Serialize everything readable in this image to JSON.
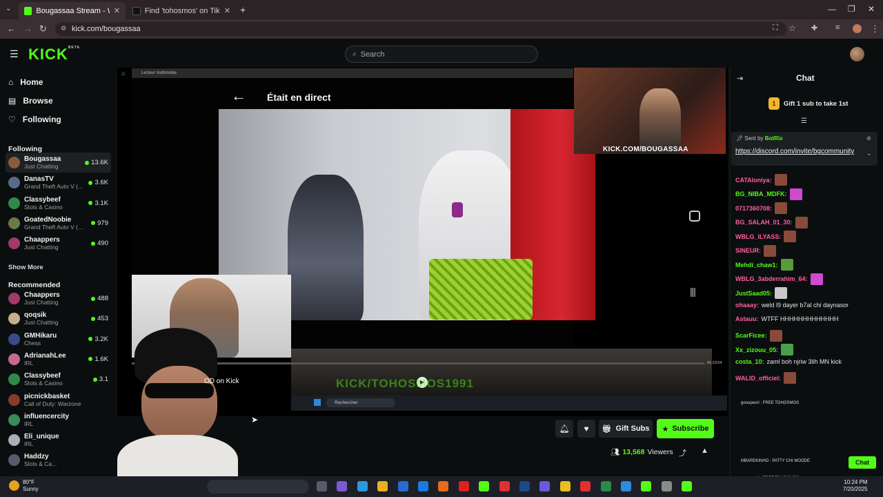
{
  "browser": {
    "tabs": [
      {
        "title": "Bougassaa Stream - Watch Live",
        "active": true
      },
      {
        "title": "Find 'tohosmos' on TikTok | Tik",
        "active": false
      }
    ],
    "url": "kick.com/bougassaa"
  },
  "header": {
    "logo": "KICK",
    "logo_tag": "BETA",
    "search_placeholder": "Search"
  },
  "sidebar": {
    "nav": [
      {
        "label": "Home",
        "icon": "home-icon"
      },
      {
        "label": "Browse",
        "icon": "browse-icon"
      },
      {
        "label": "Following",
        "icon": "heart-icon"
      }
    ],
    "following_title": "Following",
    "following": [
      {
        "name": "Bougassaa",
        "category": "Just Chatting",
        "viewers": "13.6K",
        "color": "#8a5a3a"
      },
      {
        "name": "DanasTV",
        "category": "Grand Theft Auto V (...",
        "viewers": "3.6K",
        "color": "#5a6a8a"
      },
      {
        "name": "Classybeef",
        "category": "Slots & Casino",
        "viewers": "3.1K",
        "color": "#2f8a4a"
      },
      {
        "name": "GoatedNoobie",
        "category": "Grand Theft Auto V (G...",
        "viewers": "979",
        "color": "#6a7a4a"
      },
      {
        "name": "Chaappers",
        "category": "Just Chatting",
        "viewers": "490",
        "color": "#a03a6a"
      }
    ],
    "show_more": "Show More",
    "recommended_title": "Recommended",
    "recommended": [
      {
        "name": "Chaappers",
        "category": "Just Chatting",
        "viewers": "488",
        "color": "#a03a6a"
      },
      {
        "name": "qoqsik",
        "category": "Just Chatting",
        "viewers": "453",
        "color": "#c4b08a"
      },
      {
        "name": "GMHikaru",
        "category": "Chess",
        "viewers": "3.2K",
        "color": "#3a4a8a"
      },
      {
        "name": "AdrianahLee",
        "category": "IRL",
        "viewers": "1.6K",
        "color": "#c46a8a"
      },
      {
        "name": "Classybeef",
        "category": "Slots & Casino",
        "viewers": "3.1",
        "color": "#2f8a4a"
      },
      {
        "name": "picnickbasket",
        "category": "Call of Duty: Warzone",
        "viewers": "",
        "color": "#8a3a2a"
      },
      {
        "name": "influencercity",
        "category": "IRL",
        "viewers": "",
        "color": "#3a8a5a"
      },
      {
        "name": "Eli_unique",
        "category": "IRL",
        "viewers": "",
        "color": "#aab0b8"
      },
      {
        "name": "Haddzy",
        "category": "Slots & Ca...",
        "viewers": "",
        "color": "#5a5a6a"
      }
    ]
  },
  "video": {
    "media_player_title": "Lecteur multimédia",
    "status_text": "Était en direct",
    "webcam_label": "KICK.COM/BOUGASSAA",
    "vod_text": "OD on Kick",
    "watermark": "KICK/TOHOSMOS1991",
    "inner_search": "Rechercher",
    "inner_time": "01:23:54"
  },
  "actions": {
    "gift_label": "Gift Subs",
    "subscribe_label": "Subscribe",
    "viewers_count": "13,568",
    "viewers_label": "Viewers"
  },
  "chat": {
    "title": "Chat",
    "gift_banner": "Gift 1 sub to take 1st",
    "gift_badge": "1",
    "pinned_sent_by_prefix": "Sent by",
    "pinned_sent_by": "BotRix",
    "pinned_link": "https://discord.com/invite/bgcommunity",
    "messages": [
      {
        "user": "CATAloniya:",
        "text": "",
        "color": "#ff5fa2",
        "emote": "#8a4a3a"
      },
      {
        "user": "BG_NIBA_MDFK:",
        "text": "",
        "color": "#53fc18",
        "emote": "#d04ad0"
      },
      {
        "user": "0717360708:",
        "text": "",
        "color": "#ff5fa2",
        "emote": "#8a4a3a"
      },
      {
        "user": "BG_SALAH_01_30:",
        "text": "",
        "color": "#ff5fa2",
        "emote": "#8a4a3a"
      },
      {
        "user": "WBLG_ILYASS:",
        "text": "",
        "color": "#ff5fa2",
        "emote": "#8a4a3a"
      },
      {
        "user": "SINEUR:",
        "text": "",
        "color": "#ff5fa2",
        "emote": "#8a4a3a"
      },
      {
        "user": "Mehdi_chaw1:",
        "text": "",
        "color": "#53fc18",
        "emote": "#5a9a3a"
      },
      {
        "user": "WBLG_3abderrahim_64:",
        "text": "",
        "color": "#ff5fa2",
        "emote": "#d04ad0"
      },
      {
        "user": "JustSaad05:",
        "text": "",
        "color": "#53fc18",
        "emote": "#c8c8c8"
      },
      {
        "user": "ohaaay:",
        "text": "weld l9 dayer b7al chi daynasor",
        "color": "#ff5fa2",
        "emote": ""
      },
      {
        "user": "Astauu:",
        "text": "WTFF HHHHHHHHHHHHH",
        "color": "#ff5fa2",
        "emote": ""
      },
      {
        "user": "ScarFicee:",
        "text": "",
        "color": "#53fc18",
        "emote": "#8a4a3a"
      },
      {
        "user": "Xx_zizouu_05:",
        "text": "",
        "color": "#53fc18",
        "emote": "#4aa04a"
      },
      {
        "user": "costa_10:",
        "text": "zaml boh njriw 3lih MN kick",
        "color": "#53fc18",
        "emote": ""
      },
      {
        "user": "WALID_officiel:",
        "text": "",
        "color": "#ff5fa2",
        "emote": "#8a4a3a"
      }
    ],
    "mini_lines": [
      "gooupeori : FREE TOHOSMOS",
      "MBAREKINHO : PATTY CHI MOODE",
      "gooupeori : FREE TOHOSMOS",
      "MBAREKINHO : PATTY CHI MOODE"
    ]
  },
  "taskbar": {
    "weather_temp": "80°F",
    "weather_desc": "Sunny",
    "time": "10:24 PM",
    "date": "7/20/2025"
  }
}
